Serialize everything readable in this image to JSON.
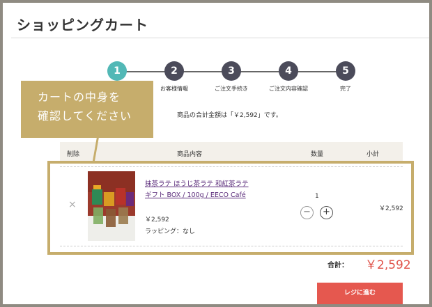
{
  "page_title": "ショッピングカート",
  "steps": [
    {
      "number": "1",
      "label": ""
    },
    {
      "number": "2",
      "label": "お客様情報"
    },
    {
      "number": "3",
      "label": "ご注文手続き"
    },
    {
      "number": "4",
      "label": "ご注文内容確認"
    },
    {
      "number": "5",
      "label": "完了"
    }
  ],
  "callout": {
    "line1": "カートの中身を",
    "line2": "確認してください"
  },
  "total_note": "商品の合計金額は「￥2,592」です。",
  "table": {
    "headers": {
      "remove": "削除",
      "product": "商品内容",
      "quantity": "数量",
      "subtotal": "小計"
    }
  },
  "item": {
    "remove_symbol": "×",
    "name": "抹茶ラテ ほうじ茶ラテ 和紅茶ラテ ギフト BOX / 100g / EECO Café",
    "price": "￥2,592",
    "wrapping": "ラッピング：なし",
    "quantity": "1",
    "minus": "−",
    "plus": "+",
    "subtotal": "￥2,592"
  },
  "total": {
    "label": "合計：",
    "value": "￥2,592"
  },
  "checkout_label": "レジに進む",
  "colors": {
    "accent_gold": "#c6ad6c",
    "active_step": "#52b8b6",
    "price_red": "#e0534a"
  }
}
